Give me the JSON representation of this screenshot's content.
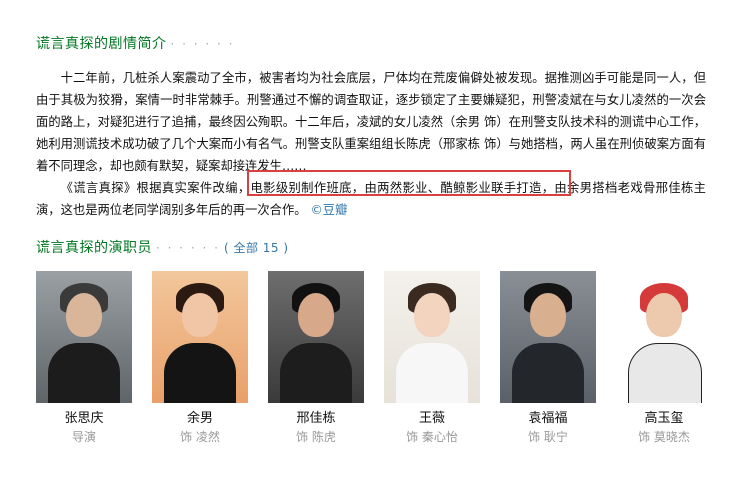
{
  "intro": {
    "title": "谎言真探的剧情简介",
    "dots": "· · · · · ·",
    "paragraph1": "十二年前，几桩杀人案震动了全市，被害者均为社会底层，尸体均在荒废偏僻处被发现。据推测凶手可能是同一人，但由于其极为狡猾，案情一时非常棘手。刑警通过不懈的调查取证，逐步锁定了主要嫌疑犯，刑警凌斌在与女儿凌然的一次会面的路上，对疑犯进行了追捕，最终因公殉职。十二年后，凌斌的女儿凌然（余男 饰）在刑警支队技术科的测谎中心工作，她利用测谎技术成功破了几个大案而小有名气。刑警支队重案组组长陈虎（邢家栋 饰）与她搭档，两人虽在刑侦破案方面有着不同理念，却也颇有默契，疑案却接连发生……",
    "p2_before": "《谎言真探》根据真实案件改编，",
    "p2_highlight": "电影级别制作班底，由两然影业、酷鲸影业联手打造，",
    "p2_after": "由余男搭档老戏骨邢佳栋主演，这也是两位老同学阔别多年后的再一次合作。",
    "source": "©豆瓣"
  },
  "cast": {
    "title": "谎言真探的演职员",
    "dots": "· · · · · ·",
    "all_label": "( 全部 15 )",
    "members": [
      {
        "name": "张思庆",
        "role": "导演"
      },
      {
        "name": "余男",
        "role": "饰 凌然"
      },
      {
        "name": "邢佳栋",
        "role": "饰 陈虎"
      },
      {
        "name": "王薇",
        "role": "饰 秦心怡"
      },
      {
        "name": "袁福福",
        "role": "饰 耿宁"
      },
      {
        "name": "高玉玺",
        "role": "饰 莫晓杰"
      }
    ]
  },
  "colors": {
    "title_green": "#007722",
    "link_blue": "#3377aa",
    "highlight_red": "#d94141"
  }
}
